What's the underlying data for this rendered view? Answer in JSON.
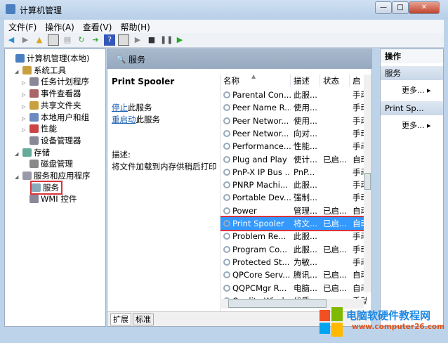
{
  "window": {
    "title": "计算机管理",
    "buttons": {
      "minimize": "—",
      "maximize": "□",
      "close": "✕"
    }
  },
  "menu": [
    "文件(F)",
    "操作(A)",
    "查看(V)",
    "帮助(H)"
  ],
  "toolbar": [
    "back-icon",
    "forward-icon",
    "up-icon",
    "show-tree-icon",
    "properties-icon",
    "refresh-icon",
    "export-icon",
    "help-icon",
    "view-icon",
    "play-icon",
    "stop-icon",
    "pause-icon",
    "restart-icon"
  ],
  "tree": [
    {
      "label": "计算机管理(本地)",
      "level": 0,
      "arrow": ""
    },
    {
      "label": "系统工具",
      "level": 1,
      "arrow": "◢"
    },
    {
      "label": "任务计划程序",
      "level": 2,
      "arrow": "▷"
    },
    {
      "label": "事件查看器",
      "level": 2,
      "arrow": "▷"
    },
    {
      "label": "共享文件夹",
      "level": 2,
      "arrow": "▷"
    },
    {
      "label": "本地用户和组",
      "level": 2,
      "arrow": "▷"
    },
    {
      "label": "性能",
      "level": 2,
      "arrow": "▷"
    },
    {
      "label": "设备管理器",
      "level": 2,
      "arrow": ""
    },
    {
      "label": "存储",
      "level": 1,
      "arrow": "◢"
    },
    {
      "label": "磁盘管理",
      "level": 2,
      "arrow": ""
    },
    {
      "label": "服务和应用程序",
      "level": 1,
      "arrow": "◢"
    },
    {
      "label": "服务",
      "level": 2,
      "arrow": "",
      "selected": true
    },
    {
      "label": "WMI 控件",
      "level": 2,
      "arrow": ""
    }
  ],
  "main": {
    "header": "服务",
    "detail": {
      "service_name": "Print Spooler",
      "stop_link": "停止",
      "stop_suffix": "此服务",
      "restart_link": "重启动",
      "restart_suffix": "此服务",
      "desc_label": "描述:",
      "desc_text": "将文件加载到内存供稍后打印"
    },
    "columns": [
      "名称",
      "描述",
      "状态",
      "启动"
    ],
    "rows": [
      [
        "Parental Con...",
        "此服...",
        "",
        "手动"
      ],
      [
        "Peer Name R...",
        "使用...",
        "",
        "手动"
      ],
      [
        "Peer Networ...",
        "使用...",
        "",
        "手动"
      ],
      [
        "Peer Networ...",
        "向对...",
        "",
        "手动"
      ],
      [
        "Performance...",
        "性能...",
        "",
        "手动"
      ],
      [
        "Plug and Play",
        "使计...",
        "已启...",
        "自动"
      ],
      [
        "PnP-X IP Bus ...",
        "PnP...",
        "",
        "手动"
      ],
      [
        "PNRP Machi...",
        "此服...",
        "",
        "手动"
      ],
      [
        "Portable Dev...",
        "强制...",
        "",
        "手动"
      ],
      [
        "Power",
        "管理...",
        "已启...",
        "自动"
      ],
      [
        "Print Spooler",
        "将文...",
        "已启...",
        "自动"
      ],
      [
        "Problem Re...",
        "此服...",
        "",
        "手动"
      ],
      [
        "Program Co...",
        "此服...",
        "已启...",
        "手动"
      ],
      [
        "Protected St...",
        "为敏...",
        "",
        "手动"
      ],
      [
        "QPCore Serv...",
        "腾讯...",
        "已启...",
        "自动"
      ],
      [
        "QQPCMgr R...",
        "电脑...",
        "已启...",
        "自动"
      ],
      [
        "Quality Wind...",
        "优质...",
        "",
        "手动"
      ]
    ],
    "selected_row": 10,
    "tabs": [
      "扩展",
      "标准"
    ]
  },
  "actions": {
    "title": "操作",
    "groups": [
      {
        "header": "服务",
        "more": "更多..."
      },
      {
        "header": "Print Sp...",
        "more": "更多..."
      }
    ]
  },
  "watermark": {
    "name": "电脑软硬件教程网",
    "url": "www.computer26.com"
  },
  "colors": {
    "selection": "#3399ff",
    "highlight_box": "#d9343a",
    "link": "#1a5fb4"
  }
}
